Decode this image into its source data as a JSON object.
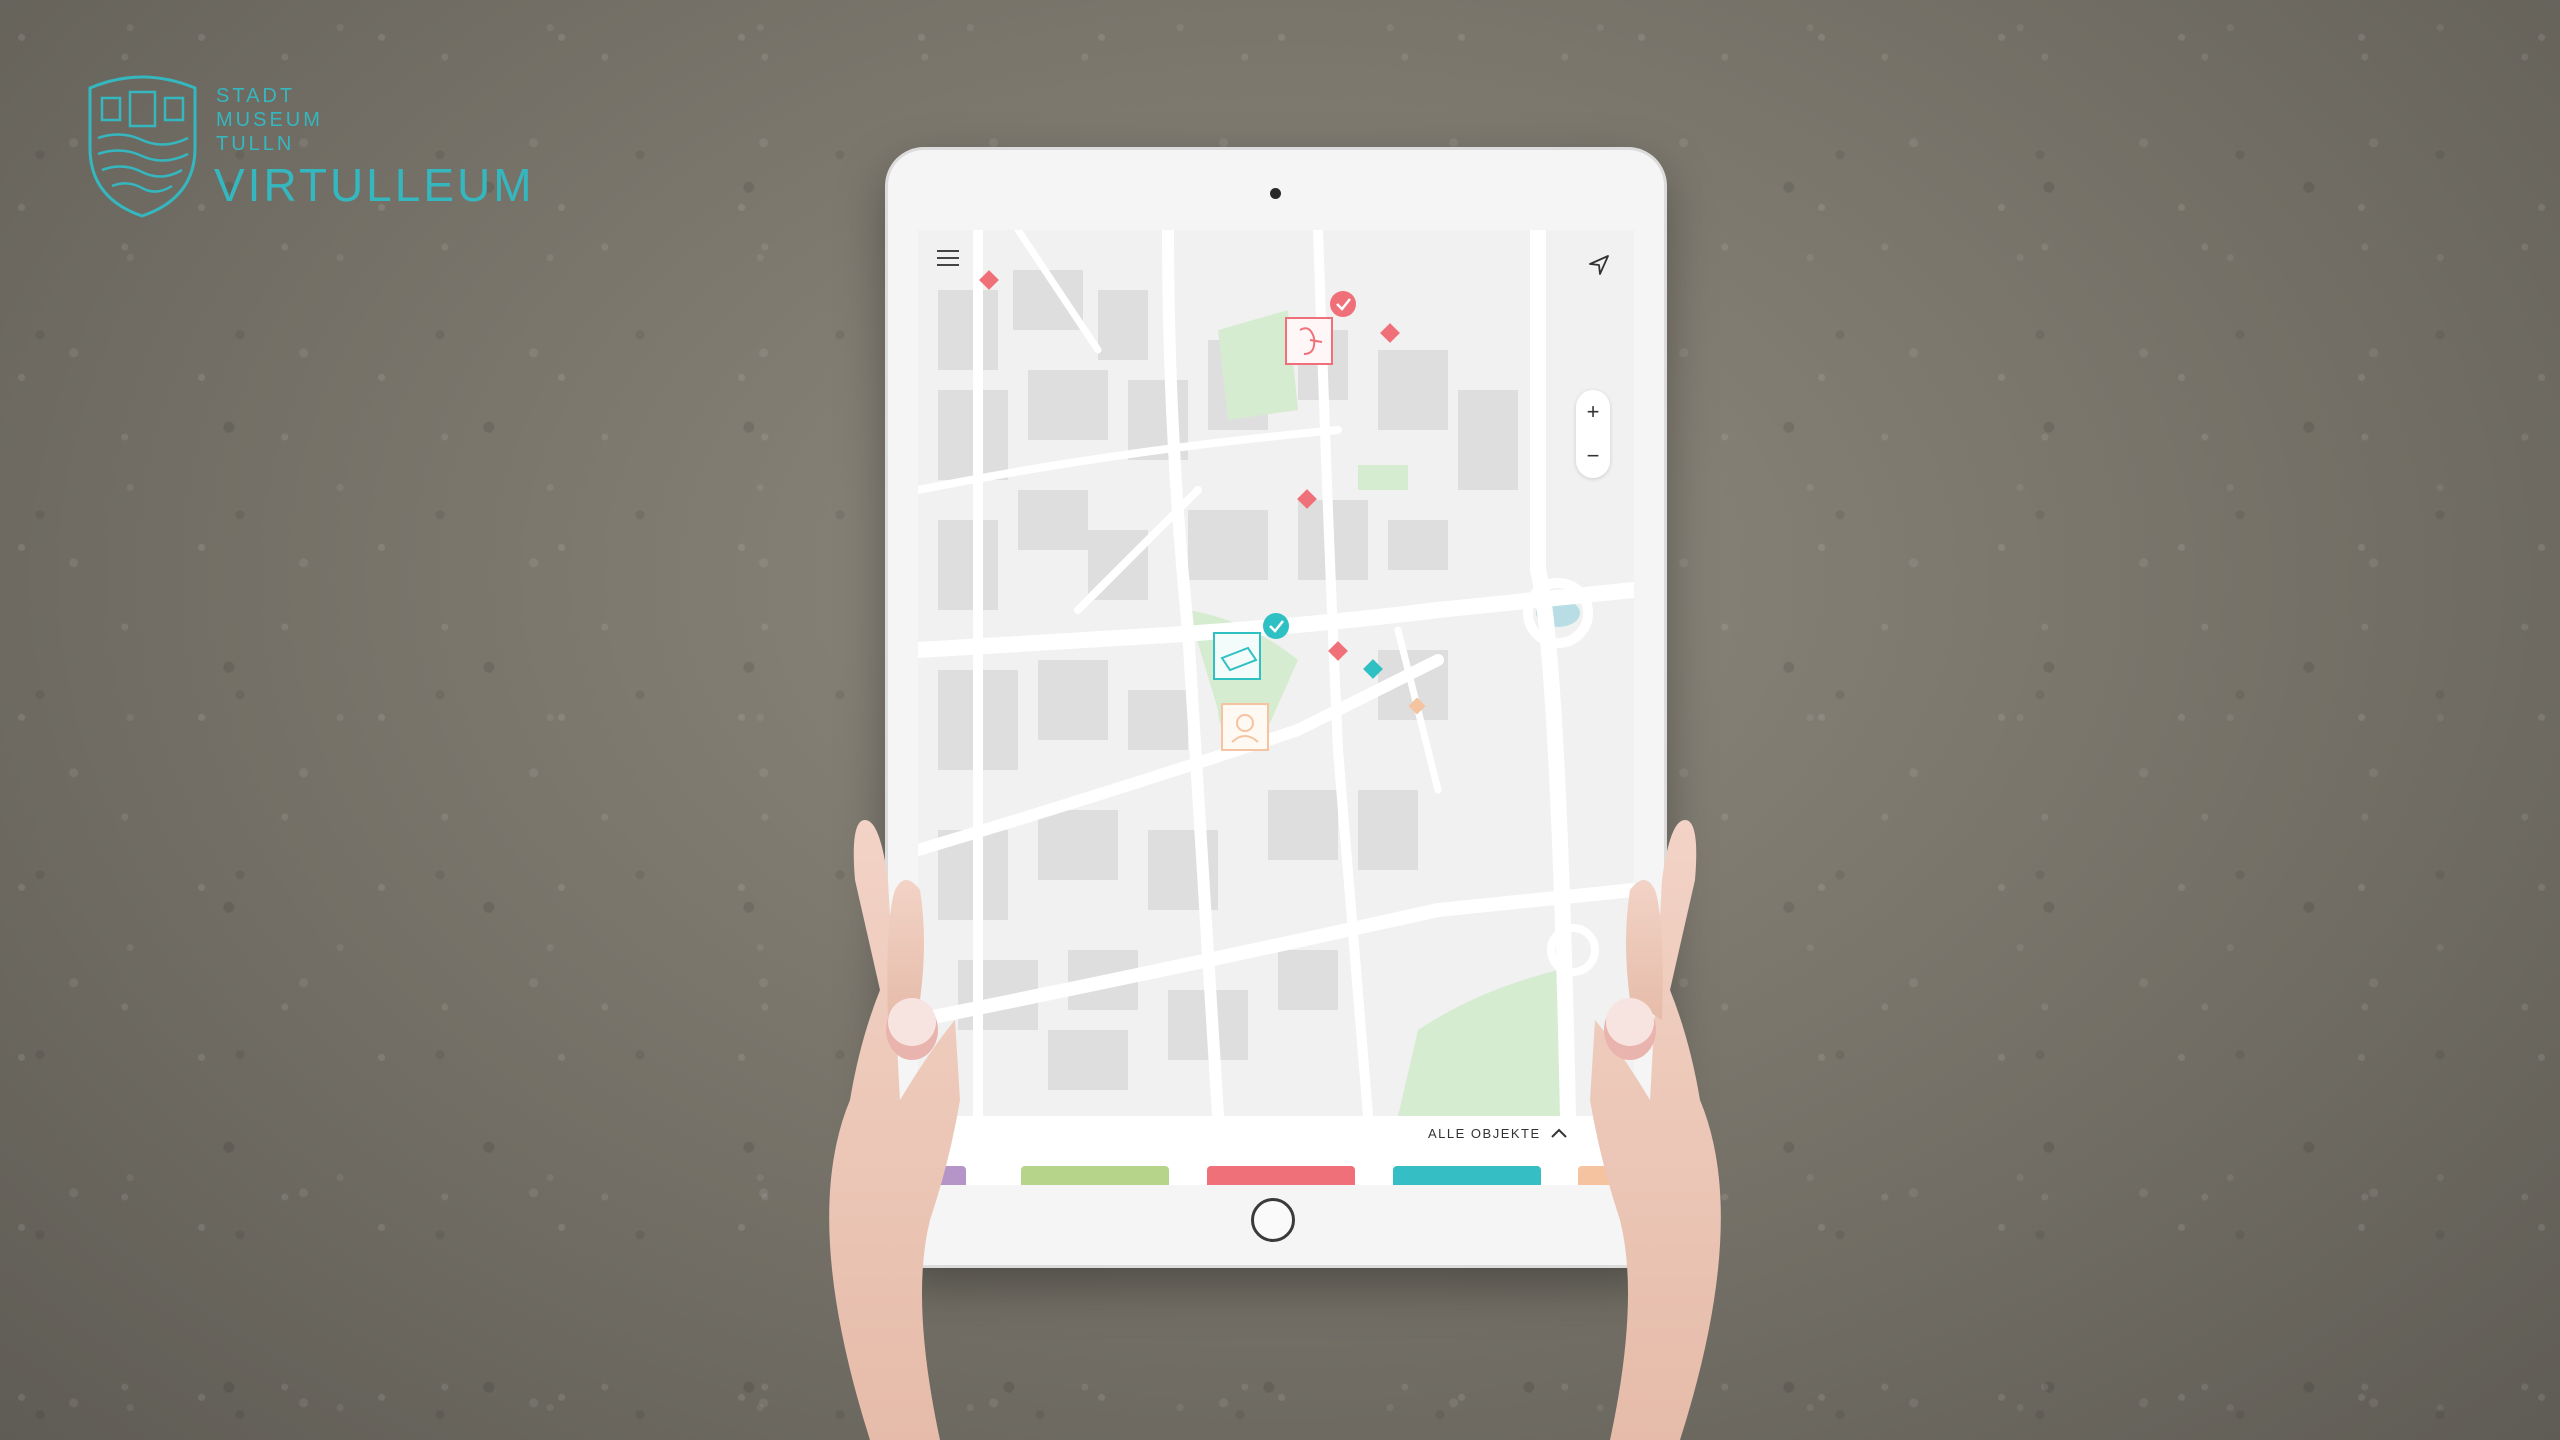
{
  "logo": {
    "line1": "STADT",
    "line2": "MUSEUM",
    "line3": "TULLN",
    "name": "VIRTULLEUM"
  },
  "colors": {
    "brand": "#35b7bf",
    "marker_red": "#f0707a",
    "marker_teal": "#2fc0c4",
    "marker_orange": "#f5c3a0",
    "park_green": "#d6ecd1",
    "water": "#b9dde4"
  },
  "map": {
    "menu_icon": "hamburger-menu-icon",
    "locate_icon": "navigation-arrow-icon",
    "zoom_in_label": "+",
    "zoom_out_label": "−",
    "filter_label": "ALLE OBJEKTE",
    "filter_icon": "chevron-up-icon"
  },
  "category_tabs": [
    {
      "color": "#b595c8"
    },
    {
      "color": "#b6d48a"
    },
    {
      "color": "#f0707a"
    },
    {
      "color": "#35bfc4"
    },
    {
      "color": "#f5c3a0"
    }
  ]
}
